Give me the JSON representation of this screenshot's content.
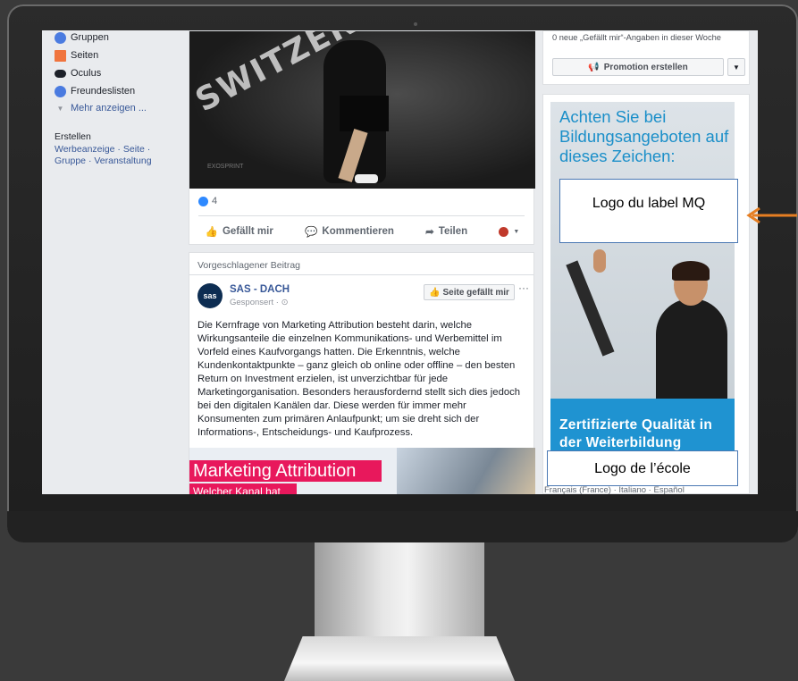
{
  "nav": {
    "items": [
      {
        "label": "Gruppen",
        "icon": "groups-icon",
        "color": "#4a7be0"
      },
      {
        "label": "Seiten",
        "icon": "flag-icon",
        "color": "#f0743d"
      },
      {
        "label": "Oculus",
        "icon": "vr-headset-icon",
        "color": "#1d2129"
      },
      {
        "label": "Freundeslisten",
        "icon": "friends-icon",
        "color": "#4a7be0"
      },
      {
        "label": "Mehr anzeigen ...",
        "icon": "chevron-down-icon",
        "color": "#90949c"
      }
    ],
    "create_heading": "Erstellen",
    "create_links": "Werbeanzeige · Seite · Gruppe · Veranstaltung"
  },
  "post1": {
    "photo_wall_text": "SWITZERLAND",
    "photo_mat_text": "EXOSPRINT",
    "like_count": "4",
    "actions": [
      "Gefällt mir",
      "Kommentieren",
      "Teilen"
    ]
  },
  "post2": {
    "header": "Vorgeschlagener Beitrag",
    "avatar_text": "sas",
    "page_name": "SAS - DACH",
    "sponsored": "Gesponsert · ",
    "like_page_button": "Seite gefällt mir",
    "more": "···",
    "body": "Die Kernfrage von Marketing Attribution besteht darin, welche Wirkungsanteile die einzelnen Kommunikations- und Werbemittel im Vorfeld eines Kaufvorgangs hatten. Die Erkenntnis, welche Kundenkontaktpunkte – ganz gleich ob online oder offline – den besten Return on Investment erzielen, ist unverzichtbar für jede Marketingorganisation. Besonders herausfordernd stellt sich dies jedoch bei den digitalen Kanälen dar. Diese werden für immer mehr Konsumenten zum primären Anlaufpunkt; um sie dreht sich der Informations-, Entscheidungs- und Kaufprozess.",
    "image_title": "Marketing Attribution",
    "image_subtitle": "Welcher Kanal hat"
  },
  "right": {
    "likes_week": "0 neue „Gefällt mir“-Angaben in dieser Woche",
    "promo_button": "Promotion erstellen",
    "languages": "Français (France) · Italiano · Español"
  },
  "ad": {
    "headline": "Achten Sie bei Bildungsangeboten auf dieses Zeichen:",
    "bottom": "Zertifizierte Qualität in der Weiterbildung",
    "accent": "#1f93d1"
  },
  "overlays": {
    "mq_label": "Logo du label MQ",
    "ecole_label": "Logo de l’école",
    "arrow_color": "#e67e22"
  }
}
